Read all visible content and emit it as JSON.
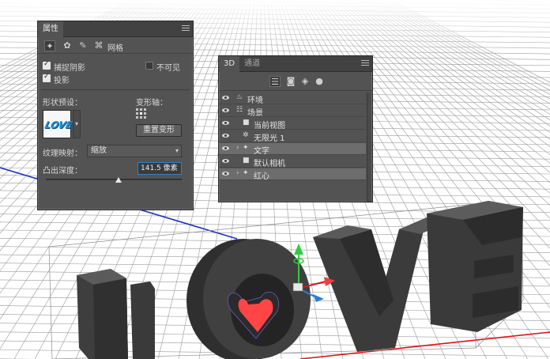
{
  "properties_panel": {
    "title": "属性",
    "mesh_tab_label": "网格",
    "cast_shadow_label": "捕捉阴影",
    "cast_shadow_checked": true,
    "shadow_label": "投影",
    "shadow_checked": true,
    "invisible_label": "不可见",
    "invisible_checked": false,
    "shape_preset_label": "形状预设：",
    "preset_thumb_text": "LOVE",
    "deform_axis_label": "变形轴：",
    "reset_deform_label": "重置变形",
    "texture_mapping_label": "纹理映射：",
    "texture_mapping_value": "缩放",
    "extrusion_depth_label": "凸出深度：",
    "extrusion_depth_value": "141.5 像素"
  },
  "panel_3d": {
    "tab_active": "3D",
    "tab_inactive": "通道",
    "layers": [
      {
        "name": "环境",
        "icon": "environment-icon",
        "expandable": false,
        "selected": false
      },
      {
        "name": "场景",
        "icon": "scene-icon",
        "expandable": false,
        "selected": false
      },
      {
        "name": "当前视图",
        "icon": "camera-icon",
        "expandable": false,
        "selected": false
      },
      {
        "name": "无限光 1",
        "icon": "infinite-light-icon",
        "expandable": false,
        "selected": false
      },
      {
        "name": "文字",
        "icon": "mesh-icon",
        "expandable": true,
        "selected": true
      },
      {
        "name": "默认相机",
        "icon": "camera-icon",
        "expandable": false,
        "selected": false
      },
      {
        "name": "红心",
        "icon": "mesh-icon",
        "expandable": true,
        "selected": true
      }
    ]
  },
  "viewport": {
    "scene_text": "LOVE",
    "accent_colors": {
      "grid": "#9a9a9a",
      "axis_blue": "#1f2fd0",
      "axis_red": "#e01010",
      "letters": "#3a3a3a",
      "heart": "#ff4040",
      "gizmo_green": "#2ecc40"
    }
  }
}
